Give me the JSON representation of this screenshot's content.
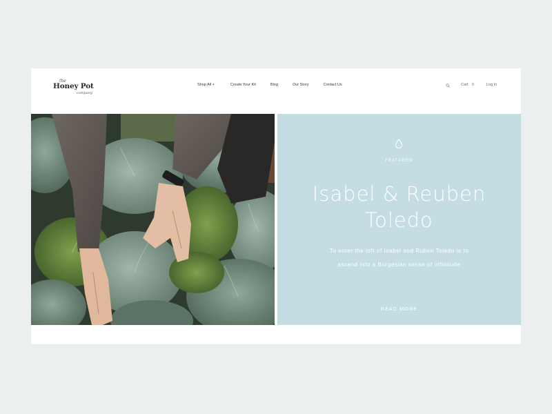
{
  "brand": {
    "the": "the",
    "name": "Honey Pot",
    "company": "company"
  },
  "nav": {
    "items": [
      {
        "label": "Shop All +"
      },
      {
        "label": "Create Your Kit"
      },
      {
        "label": "Blog"
      },
      {
        "label": "Our Story"
      },
      {
        "label": "Contact Us"
      }
    ]
  },
  "header": {
    "search_icon": "search-icon",
    "cart_label": "Cart",
    "cart_count": "0",
    "login_label": "Log In"
  },
  "hero": {
    "icon": "water-drop-icon",
    "featured_label": "FEATURED",
    "title_line1": "Isabel & Reuben",
    "title_line2": "Toledo",
    "description_line1": "To enter the loft of Isabel and Ruben Toledo is to",
    "description_line2": "ascend into a Borgesian sense of infinitude",
    "read_more": "READ MORE",
    "panel_color": "#c4dde3",
    "photo_subject": "hands harvesting kale in a garden"
  }
}
